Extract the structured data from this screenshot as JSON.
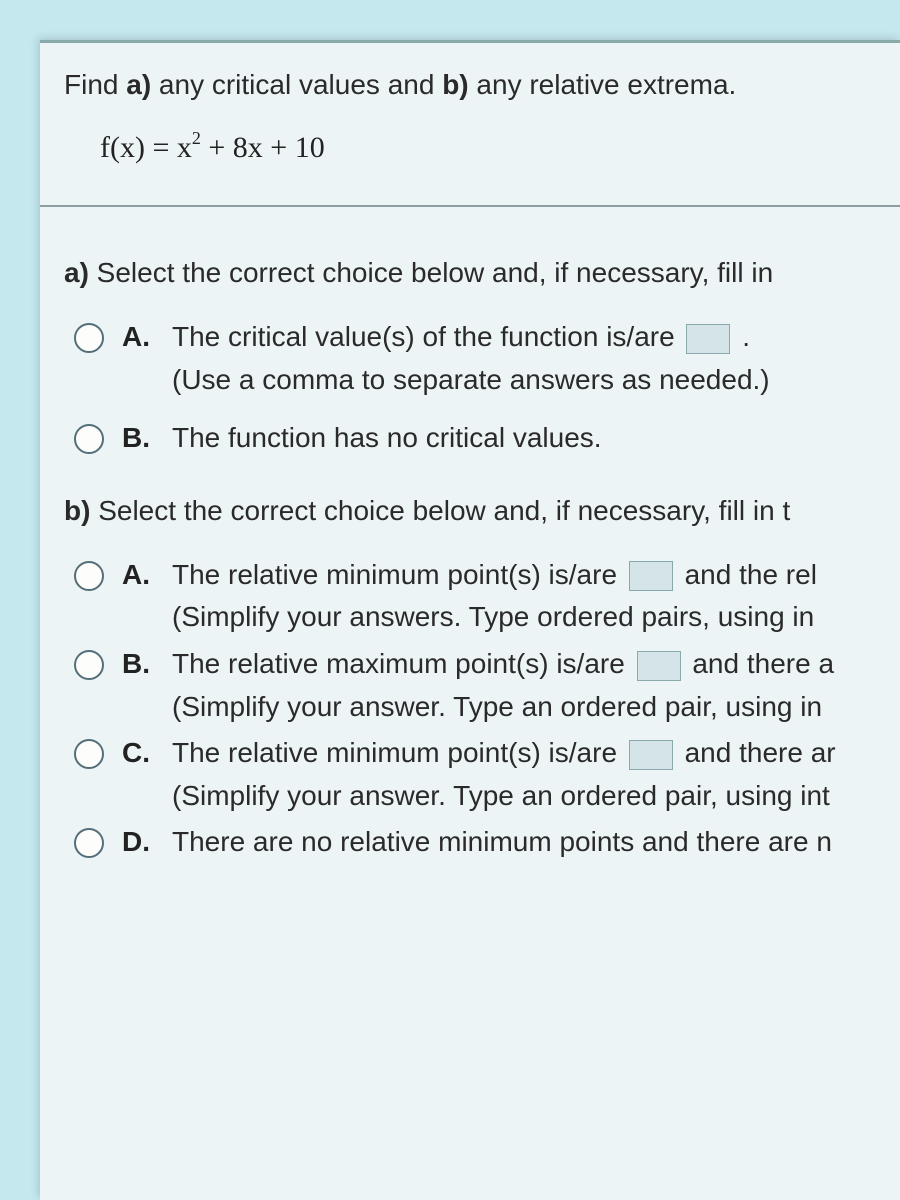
{
  "prompt_prefix": "Find ",
  "prompt_a_bold": "a)",
  "prompt_mid1": " any critical values and ",
  "prompt_b_bold": "b)",
  "prompt_mid2": " any relative extrema.",
  "formula_left": "f(x) = x",
  "formula_exp": "2",
  "formula_right": " + 8x + 10",
  "partA": {
    "label_bold": "a)",
    "label_rest": " Select the correct choice below and, if necessary, fill in",
    "A": {
      "letter": "A.",
      "line1_pre": "The critical value(s) of the function is/are ",
      "line1_post": " .",
      "line2": "(Use a comma to separate answers as needed.)"
    },
    "B": {
      "letter": "B.",
      "line1": "The function has no critical values."
    }
  },
  "partB": {
    "label_bold": "b)",
    "label_rest": " Select the correct choice below and, if necessary, fill in t",
    "A": {
      "letter": "A.",
      "l1_pre": "The relative minimum point(s) is/are ",
      "l1_post": " and the rel",
      "l2": "(Simplify your answers. Type ordered pairs, using in"
    },
    "B": {
      "letter": "B.",
      "l1_pre": "The relative maximum point(s) is/are ",
      "l1_post": " and there a",
      "l2": "(Simplify your answer. Type an ordered pair, using in"
    },
    "C": {
      "letter": "C.",
      "l1_pre": "The relative minimum point(s) is/are ",
      "l1_post": " and there ar",
      "l2": "(Simplify your answer. Type an ordered pair, using int"
    },
    "D": {
      "letter": "D.",
      "l1": "There are no relative minimum points and there are n"
    }
  }
}
